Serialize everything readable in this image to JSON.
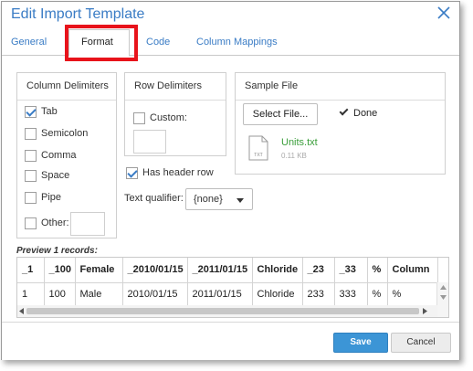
{
  "dialog": {
    "title": "Edit Import Template"
  },
  "tabs": [
    {
      "label": "General"
    },
    {
      "label": "Format"
    },
    {
      "label": "Code"
    },
    {
      "label": "Column Mappings"
    }
  ],
  "active_tab": "Format",
  "column_delimiters": {
    "header": "Column Delimiters",
    "options": [
      {
        "label": "Tab",
        "checked": true
      },
      {
        "label": "Semicolon",
        "checked": false
      },
      {
        "label": "Comma",
        "checked": false
      },
      {
        "label": "Space",
        "checked": false
      },
      {
        "label": "Pipe",
        "checked": false
      },
      {
        "label": "Other:",
        "checked": false
      }
    ],
    "other_value": ""
  },
  "row_delimiters": {
    "header": "Row Delimiters",
    "custom_label": "Custom:",
    "custom_checked": false,
    "custom_value": ""
  },
  "has_header_row": {
    "label": "Has header row",
    "checked": true
  },
  "text_qualifier": {
    "label": "Text qualifier:",
    "value": "{none}"
  },
  "sample_file": {
    "header": "Sample File",
    "select_button": "Select File...",
    "done_label": "Done",
    "file_name": "Units.txt",
    "file_size": "0.11 KB",
    "file_icon_text": "TXT"
  },
  "preview": {
    "label": "Preview 1 records:",
    "columns": [
      "_1",
      "_100",
      "Female",
      "_2010/01/15",
      "_2011/01/15",
      "Chloride",
      "_23",
      "_33",
      "%",
      "Column"
    ],
    "rows": [
      [
        "1",
        "100",
        "Male",
        "2010/01/15",
        "2011/01/15",
        "Chloride",
        "233",
        "333",
        "%",
        "%"
      ]
    ]
  },
  "footer": {
    "save_label": "Save",
    "cancel_label": "Cancel"
  },
  "colors": {
    "accent": "#3a7cc5",
    "save": "#3c95d6",
    "highlight": "#e8131b",
    "file_name": "#3a9e3a"
  }
}
